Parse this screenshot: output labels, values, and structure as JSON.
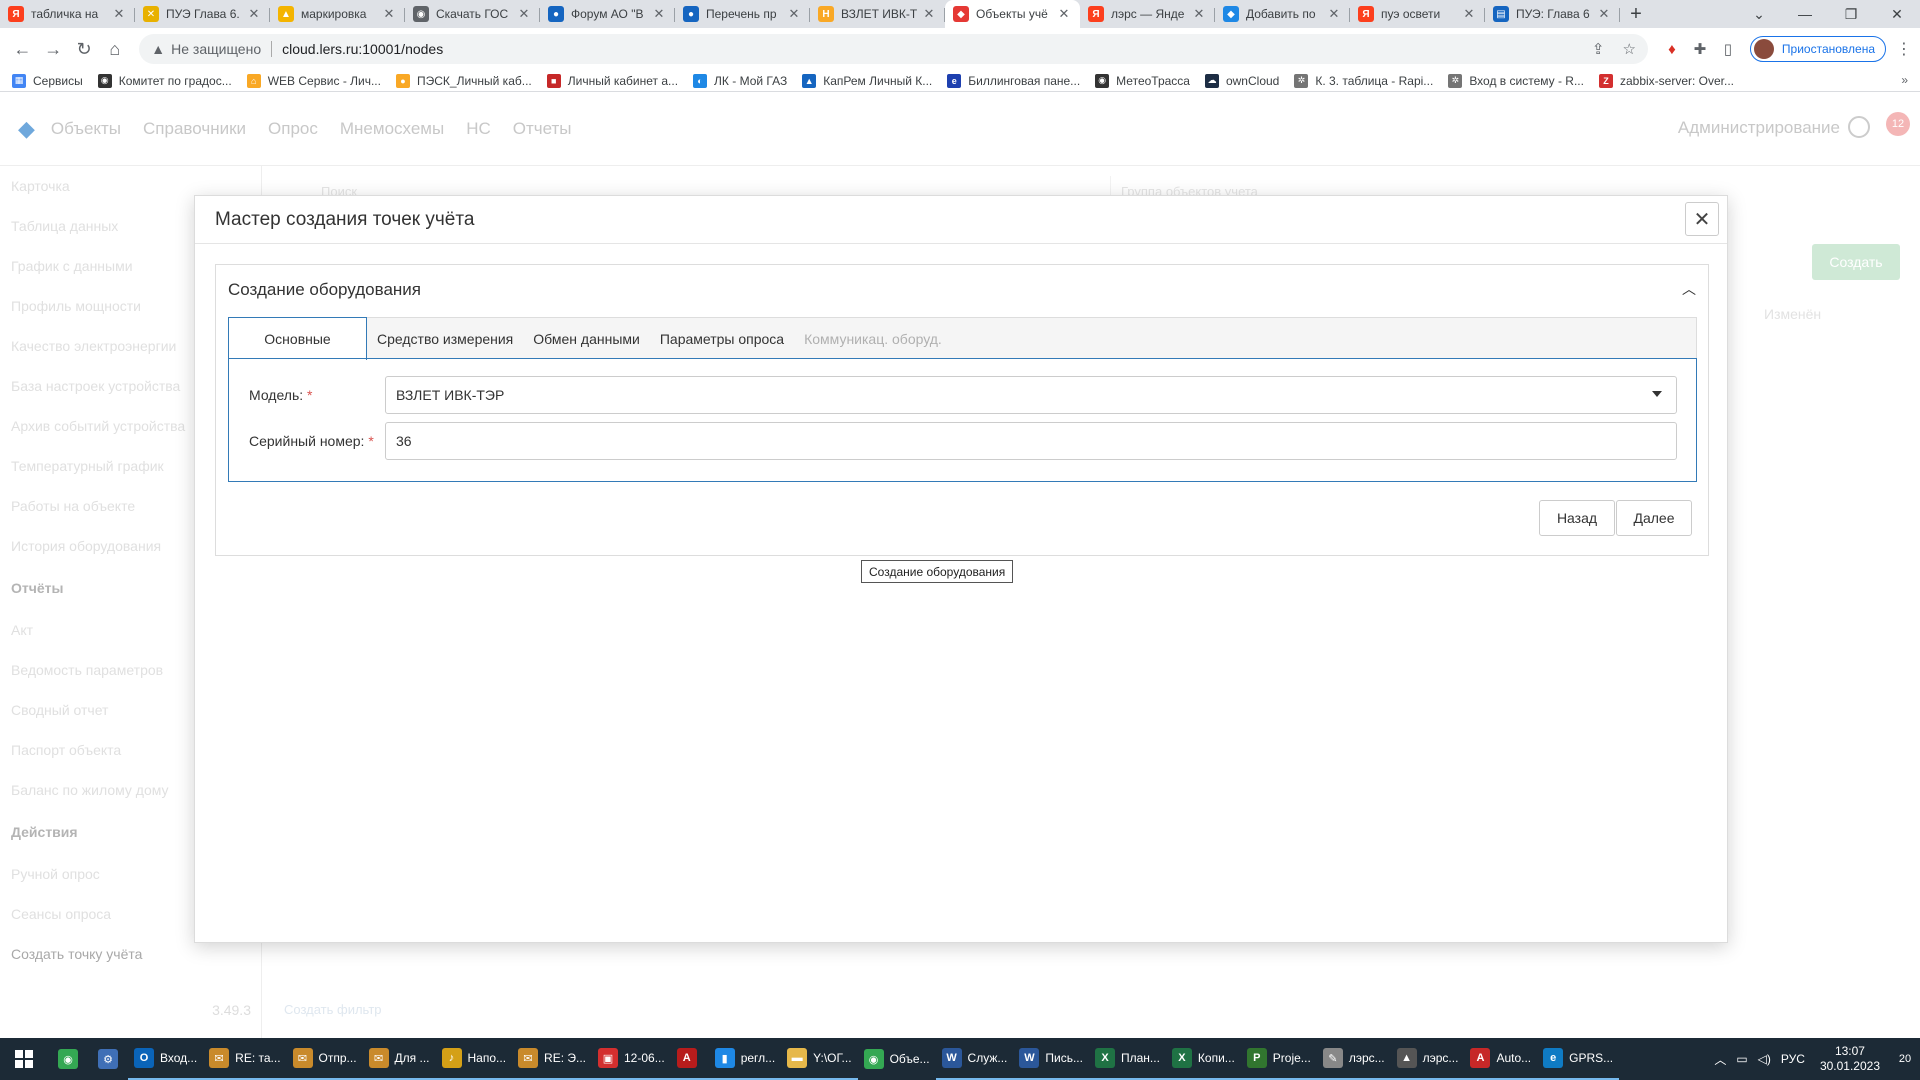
{
  "browser": {
    "tabs": [
      {
        "title": "табличка на",
        "icon": "yandex-icon",
        "color": "#fc3f1d",
        "glyph": "Я"
      },
      {
        "title": "ПУЭ Глава 6.",
        "icon": "tools-icon",
        "color": "#e8b100",
        "glyph": "✕"
      },
      {
        "title": "маркировка",
        "icon": "image-icon",
        "color": "#f4b400",
        "glyph": "▲"
      },
      {
        "title": "Скачать ГОС",
        "icon": "globe-icon",
        "color": "#5f6368",
        "glyph": "◉"
      },
      {
        "title": "Форум АО \"В",
        "icon": "forum-icon",
        "color": "#1565c0",
        "glyph": "●"
      },
      {
        "title": "Перечень пр",
        "icon": "forum-icon",
        "color": "#1565c0",
        "glyph": "●"
      },
      {
        "title": "ВЗЛЕТ ИВК-Т",
        "icon": "vzlet-icon",
        "color": "#f9a825",
        "glyph": "Н"
      },
      {
        "title": "Объекты учё",
        "icon": "lers-icon",
        "color": "#e53935",
        "glyph": "◆"
      },
      {
        "title": "лэрс — Янде",
        "icon": "yandex-icon",
        "color": "#fc3f1d",
        "glyph": "Я"
      },
      {
        "title": "Добавить по",
        "icon": "lers-icon",
        "color": "#1e88e5",
        "glyph": "◆"
      },
      {
        "title": "пуэ освети",
        "icon": "yandex-icon",
        "color": "#fc3f1d",
        "glyph": "Я"
      },
      {
        "title": "ПУЭ: Глава 6",
        "icon": "doc-icon",
        "color": "#1565c0",
        "glyph": "▤"
      }
    ],
    "active_tab": 7,
    "new_tab": "+",
    "address": {
      "warning": "Не защищено",
      "url": "cloud.lers.ru:10001/nodes"
    },
    "profile": "Приостановлена",
    "bookmarks": [
      {
        "label": "Сервисы",
        "icon": "apps-icon",
        "color": "#4285f4",
        "glyph": "▦"
      },
      {
        "label": "Комитет по градос...",
        "icon": "globe-icon",
        "color": "#333333",
        "glyph": "◉"
      },
      {
        "label": "WEB Сервис - Лич...",
        "icon": "home-icon",
        "color": "#f9a825",
        "glyph": "⌂"
      },
      {
        "label": "ПЭСК_Личный каб...",
        "icon": "bulb-icon",
        "color": "#f9a825",
        "glyph": "●"
      },
      {
        "label": "Личный кабинет а...",
        "icon": "cabinet-icon",
        "color": "#c62828",
        "glyph": "■"
      },
      {
        "label": "ЛК - Мой ГАЗ",
        "icon": "gas-icon",
        "color": "#1e88e5",
        "glyph": "◐"
      },
      {
        "label": "КапРем Личный К...",
        "icon": "house-icon",
        "color": "#1565c0",
        "glyph": "▲"
      },
      {
        "label": "Биллинговая пане...",
        "icon": "billing-icon",
        "color": "#1e40af",
        "glyph": "e"
      },
      {
        "label": "МетеоТрасса",
        "icon": "globe-icon",
        "color": "#333333",
        "glyph": "◉"
      },
      {
        "label": "ownCloud",
        "icon": "cloud-icon",
        "color": "#1d2d44",
        "glyph": "☁"
      },
      {
        "label": "К. 3. таблица - Rapi...",
        "icon": "gear-icon",
        "color": "#757575",
        "glyph": "✲"
      },
      {
        "label": "Вход в систему - R...",
        "icon": "gear-icon",
        "color": "#757575",
        "glyph": "✲"
      },
      {
        "label": "zabbix-server: Over...",
        "icon": "zabbix-icon",
        "color": "#d32f2f",
        "glyph": "Z"
      }
    ]
  },
  "app": {
    "nav": [
      "Объекты",
      "Справочники",
      "Опрос",
      "Мнемосхемы",
      "НС",
      "Отчеты"
    ],
    "admin": "Администрирование",
    "notifications": "12",
    "sidebar_items": [
      "Карточка",
      "Таблица данных",
      "График с данными",
      "Профиль мощности",
      "Качество электроэнергии",
      "База настроек устройства",
      "Архив событий устройства",
      "Температурный график",
      "Работы на объекте",
      "История оборудования"
    ],
    "sidebar_reports_header": "Отчёты",
    "sidebar_reports": [
      "Акт",
      "Ведомость параметров",
      "Сводный отчет",
      "Паспорт объекта",
      "Баланс по жилому дому"
    ],
    "sidebar_actions_header": "Действия",
    "sidebar_actions": [
      "Ручной опрос",
      "Сеансы опроса"
    ],
    "sidebar_create": "Создать точку учёта",
    "version": "3.49.3",
    "search_placeholder": "Поиск",
    "group_placeholder": "Группа объектов учета",
    "create_button": "Создать",
    "changed_column": "Изменён",
    "create_filter": "Создать фильтр"
  },
  "modal": {
    "title": "Мастер создания точек учёта",
    "close": "✕",
    "panel_title": "Создание оборудования",
    "tabs": [
      {
        "label": "Основные",
        "state": "active"
      },
      {
        "label": "Средство измерения",
        "state": "normal"
      },
      {
        "label": "Обмен данными",
        "state": "normal"
      },
      {
        "label": "Параметры опроса",
        "state": "normal"
      },
      {
        "label": "Коммуникац. оборуд.",
        "state": "disabled"
      }
    ],
    "fields": {
      "model_label": "Модель:",
      "model_value": "ВЗЛЕТ ИВК-ТЭР",
      "serial_label": "Серийный номер:",
      "serial_value": "36",
      "required_mark": "*"
    },
    "back_button": "Назад",
    "next_button": "Далее",
    "tooltip": "Создание оборудования"
  },
  "taskbar": {
    "pinned": [
      {
        "icon": "chrome-icon",
        "color": "#34a853",
        "glyph": "◉"
      },
      {
        "icon": "network-icon",
        "color": "#3f6fb6",
        "glyph": "⚙"
      }
    ],
    "items": [
      {
        "label": "Вход...",
        "icon": "outlook-icon",
        "color": "#0a64b9",
        "glyph": "O",
        "state": "open"
      },
      {
        "label": "RE: та...",
        "icon": "mail-icon",
        "color": "#c98a2b",
        "glyph": "✉",
        "state": "open"
      },
      {
        "label": "Отпр...",
        "icon": "mail-icon",
        "color": "#c98a2b",
        "glyph": "✉",
        "state": "open"
      },
      {
        "label": "Для ...",
        "icon": "mail-icon",
        "color": "#c98a2b",
        "glyph": "✉",
        "state": "open"
      },
      {
        "label": "Напо...",
        "icon": "bell-icon",
        "color": "#d4a017",
        "glyph": "♪",
        "state": "open"
      },
      {
        "label": "RE: Э...",
        "icon": "mail-icon",
        "color": "#c98a2b",
        "glyph": "✉",
        "state": "open"
      },
      {
        "label": "12-06...",
        "icon": "pdf-icon",
        "color": "#d32f2f",
        "glyph": "▣",
        "state": "open"
      },
      {
        "label": "",
        "icon": "acrobat-icon",
        "color": "#b71c1c",
        "glyph": "A",
        "state": "open"
      },
      {
        "label": "регл...",
        "icon": "file-icon",
        "color": "#1e88e5",
        "glyph": "▮",
        "state": "open"
      },
      {
        "label": "Y:\\ОГ...",
        "icon": "folder-icon",
        "color": "#e6b84a",
        "glyph": "▬",
        "state": "open"
      },
      {
        "label": "Объе...",
        "icon": "chrome-icon",
        "color": "#34a853",
        "glyph": "◉",
        "state": "active"
      },
      {
        "label": "Служ...",
        "icon": "word-icon",
        "color": "#2b579a",
        "glyph": "W",
        "state": "open"
      },
      {
        "label": "Пись...",
        "icon": "word-icon",
        "color": "#2b579a",
        "glyph": "W",
        "state": "open"
      },
      {
        "label": "План...",
        "icon": "excel-icon",
        "color": "#1f7244",
        "glyph": "X",
        "state": "open"
      },
      {
        "label": "Копи...",
        "icon": "excel-icon",
        "color": "#1f7244",
        "glyph": "X",
        "state": "open"
      },
      {
        "label": "Proje...",
        "icon": "project-icon",
        "color": "#31752f",
        "glyph": "P",
        "state": "open"
      },
      {
        "label": "лэрс...",
        "icon": "paint-icon",
        "color": "#888888",
        "glyph": "✎",
        "state": "open"
      },
      {
        "label": "лэрс...",
        "icon": "photos-icon",
        "color": "#555555",
        "glyph": "▲",
        "state": "open"
      },
      {
        "label": "Auto...",
        "icon": "autocad-icon",
        "color": "#c62828",
        "glyph": "A",
        "state": "open"
      },
      {
        "label": "GPRS...",
        "icon": "edge-icon",
        "color": "#0f7bc4",
        "glyph": "e",
        "state": "open"
      }
    ],
    "language": "РУС",
    "time": "13:07",
    "date": "30.01.2023",
    "notifications": "20"
  }
}
